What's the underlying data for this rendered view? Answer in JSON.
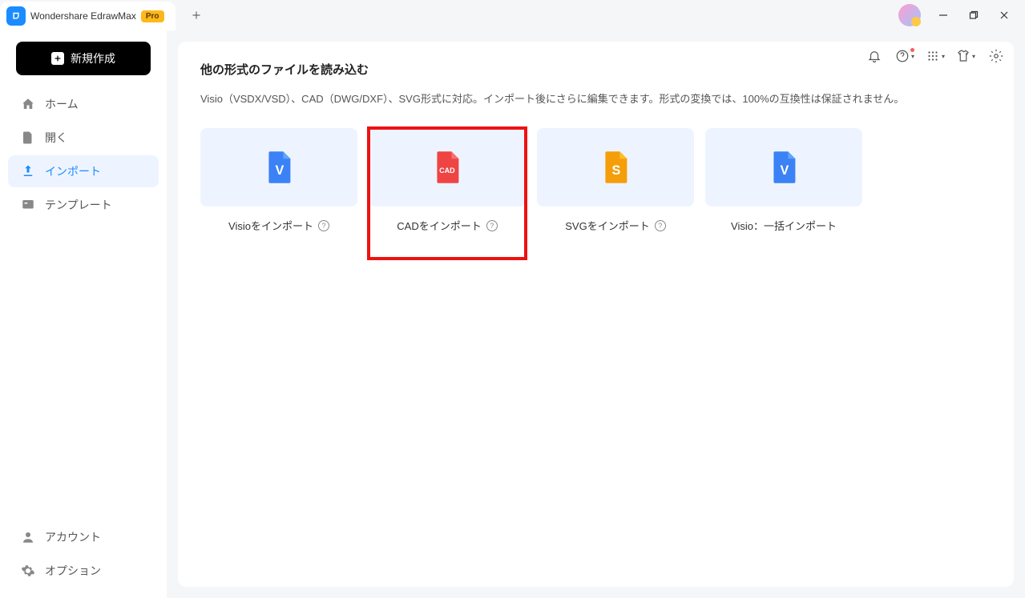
{
  "titlebar": {
    "app_name": "Wondershare EdrawMax",
    "badge": "Pro"
  },
  "sidebar": {
    "new_button": "新規作成",
    "items": [
      {
        "label": "ホーム"
      },
      {
        "label": "開く"
      },
      {
        "label": "インポート"
      },
      {
        "label": "テンプレート"
      }
    ],
    "bottom": [
      {
        "label": "アカウント"
      },
      {
        "label": "オプション"
      }
    ]
  },
  "page": {
    "title": "他の形式のファイルを読み込む",
    "description": "Visio（VSDX/VSD）、CAD（DWG/DXF）、SVG形式に対応。インポート後にさらに編集できます。形式の変換では、100%の互換性は保証されません。"
  },
  "cards": [
    {
      "label": "Visioをインポート",
      "help": true,
      "type": "visio",
      "highlighted": false
    },
    {
      "label": "CADをインポート",
      "help": true,
      "type": "cad",
      "highlighted": true
    },
    {
      "label": "SVGをインポート",
      "help": true,
      "type": "svg",
      "highlighted": false
    },
    {
      "label": "Visio：一括インポート",
      "help": false,
      "type": "visio",
      "highlighted": false
    }
  ]
}
